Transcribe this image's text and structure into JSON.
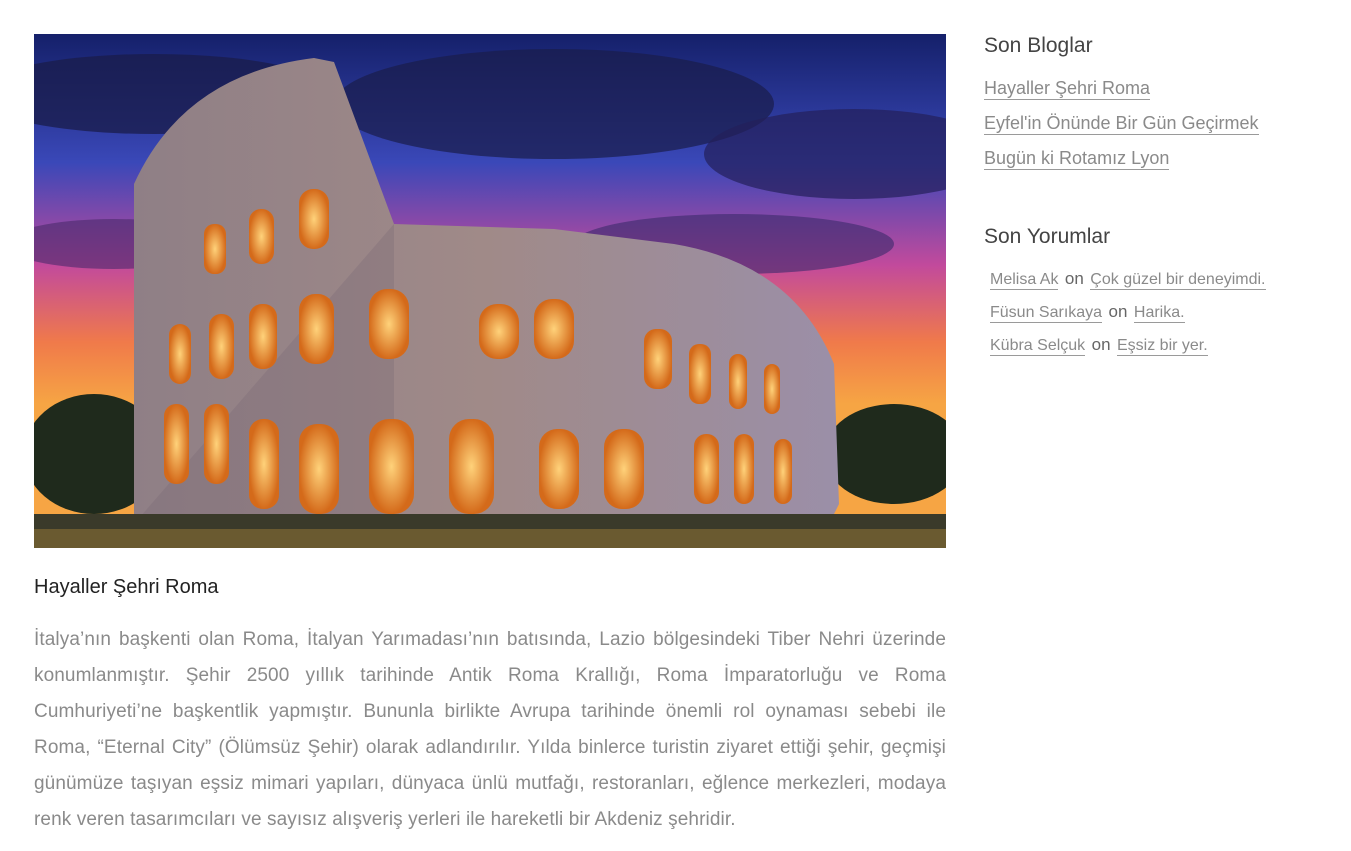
{
  "article": {
    "image_alt": "Colosseum",
    "title": "Hayaller Şehri Roma",
    "body": "İtalya’nın başkenti olan Roma, İtalyan Yarımadası’nın batısında, Lazio bölgesindeki Tiber Nehri üzerinde konumlanmıştır. Şehir 2500 yıllık tarihinde Antik Roma Krallığı, Roma İmparatorluğu ve Roma Cumhuriyeti’ne başkentlik yapmıştır. Bununla birlikte Avrupa tarihinde önemli rol oynaması sebebi ile Roma, “Eternal City” (Ölümsüz Şehir) olarak adlandırılır. Yılda binlerce turistin ziyaret ettiği şehir, geçmişi günümüze taşıyan eşsiz mimari yapıları, dünyaca ünlü mutfağı, restoranları, eğlence merkezleri, modaya renk veren tasarımcıları ve sayısız alışveriş yerleri ile hareketli bir Akdeniz şehridir."
  },
  "sidebar": {
    "recent_blogs": {
      "title": "Son Bloglar",
      "items": [
        {
          "label": "Hayaller Şehri Roma"
        },
        {
          "label": "Eyfel'in Önünde Bir Gün Geçirmek"
        },
        {
          "label": "Bugün ki Rotamız Lyon"
        }
      ]
    },
    "recent_comments": {
      "title": "Son Yorumlar",
      "connector": "on",
      "items": [
        {
          "author": "Melisa Ak",
          "comment": "Çok güzel bir deneyimdi."
        },
        {
          "author": "Füsun Sarıkaya",
          "comment": "Harika."
        },
        {
          "author": "Kübra Selçuk",
          "comment": "Eşsiz bir yer."
        }
      ]
    }
  }
}
